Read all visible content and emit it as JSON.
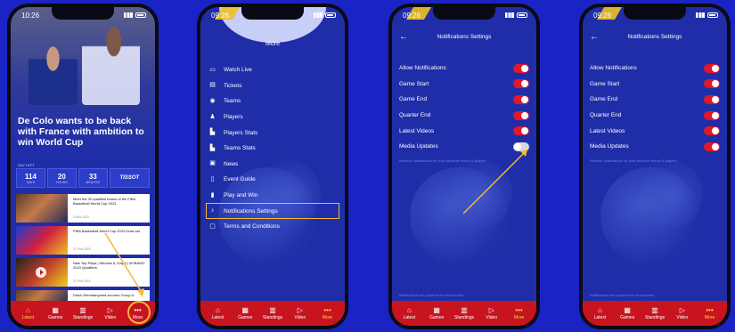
{
  "phone1": {
    "time": "10:26",
    "headline": "De Colo wants to be back with France with ambition to win World Cup",
    "countdown_label": "DAY LEFT",
    "countdown": [
      {
        "value": "114",
        "unit": "DAYS"
      },
      {
        "value": "20",
        "unit": "HOURS"
      },
      {
        "value": "33",
        "unit": "MINUTES"
      }
    ],
    "sponsor": "TISSOT",
    "news": [
      {
        "title": "Meet the 32 qualified teams of the FIBA Basketball World Cup 2023",
        "date": "3 Mar 2023"
      },
      {
        "title": "FIBA Basketball World Cup 2023 Draw set",
        "date": "27 Feb 2023"
      },
      {
        "title": "Nike Top Plays | Window 6, Day 4 | #FIBAWC 2023 Qualifiers",
        "date": "27 Feb 2023"
      },
      {
        "title": "Dutch Wembanyama secures Group A",
        "date": ""
      }
    ]
  },
  "phone2": {
    "time": "09:26",
    "title": "More",
    "menu": [
      {
        "label": "Watch Live",
        "icon": "tv-icon"
      },
      {
        "label": "Tickets",
        "icon": "ticket-icon"
      },
      {
        "label": "Teams",
        "icon": "teams-icon"
      },
      {
        "label": "Players",
        "icon": "player-icon"
      },
      {
        "label": "Players Stats",
        "icon": "stats-icon"
      },
      {
        "label": "Teams Stats",
        "icon": "stats-icon"
      },
      {
        "label": "News",
        "icon": "news-icon"
      },
      {
        "label": "Event Guide",
        "icon": "book-icon"
      },
      {
        "label": "Play and Win",
        "icon": "bookmark-icon"
      },
      {
        "label": "Notifications Settings",
        "icon": "bell-icon"
      },
      {
        "label": "Terms and Conditions",
        "icon": "document-icon"
      }
    ]
  },
  "phone3": {
    "time": "09:26",
    "title": "Notifications Settings",
    "rows": [
      {
        "label": "Allow Notifications",
        "on": true
      },
      {
        "label": "Game Start",
        "on": true
      },
      {
        "label": "Game End",
        "on": true
      },
      {
        "label": "Quarter End",
        "on": true
      },
      {
        "label": "Latest Videos",
        "on": true
      },
      {
        "label": "Media Updates",
        "on": false
      }
    ],
    "hint": "Receive notifications for your favourite teams & players",
    "powered": "Notifications are powered by Pushwoosh"
  },
  "phone4": {
    "time": "09:26",
    "title": "Notifications Settings",
    "rows": [
      {
        "label": "Allow Notifications",
        "on": true
      },
      {
        "label": "Game Start",
        "on": true
      },
      {
        "label": "Game End",
        "on": true
      },
      {
        "label": "Quarter End",
        "on": true
      },
      {
        "label": "Latest Videos",
        "on": true
      },
      {
        "label": "Media Updates",
        "on": true
      }
    ],
    "hint": "Receive notifications for your favourite teams & players",
    "powered": "Notifications are powered by Pushwoosh"
  },
  "tabbar": [
    {
      "label": "Latest",
      "icon": "home-icon"
    },
    {
      "label": "Games",
      "icon": "calendar-icon"
    },
    {
      "label": "Standings",
      "icon": "standings-icon"
    },
    {
      "label": "Video",
      "icon": "play-icon"
    },
    {
      "label": "More",
      "icon": "more-icon"
    }
  ],
  "colors": {
    "accent": "#c8141e",
    "highlight": "#f2b93b",
    "background": "#1a23c4"
  }
}
